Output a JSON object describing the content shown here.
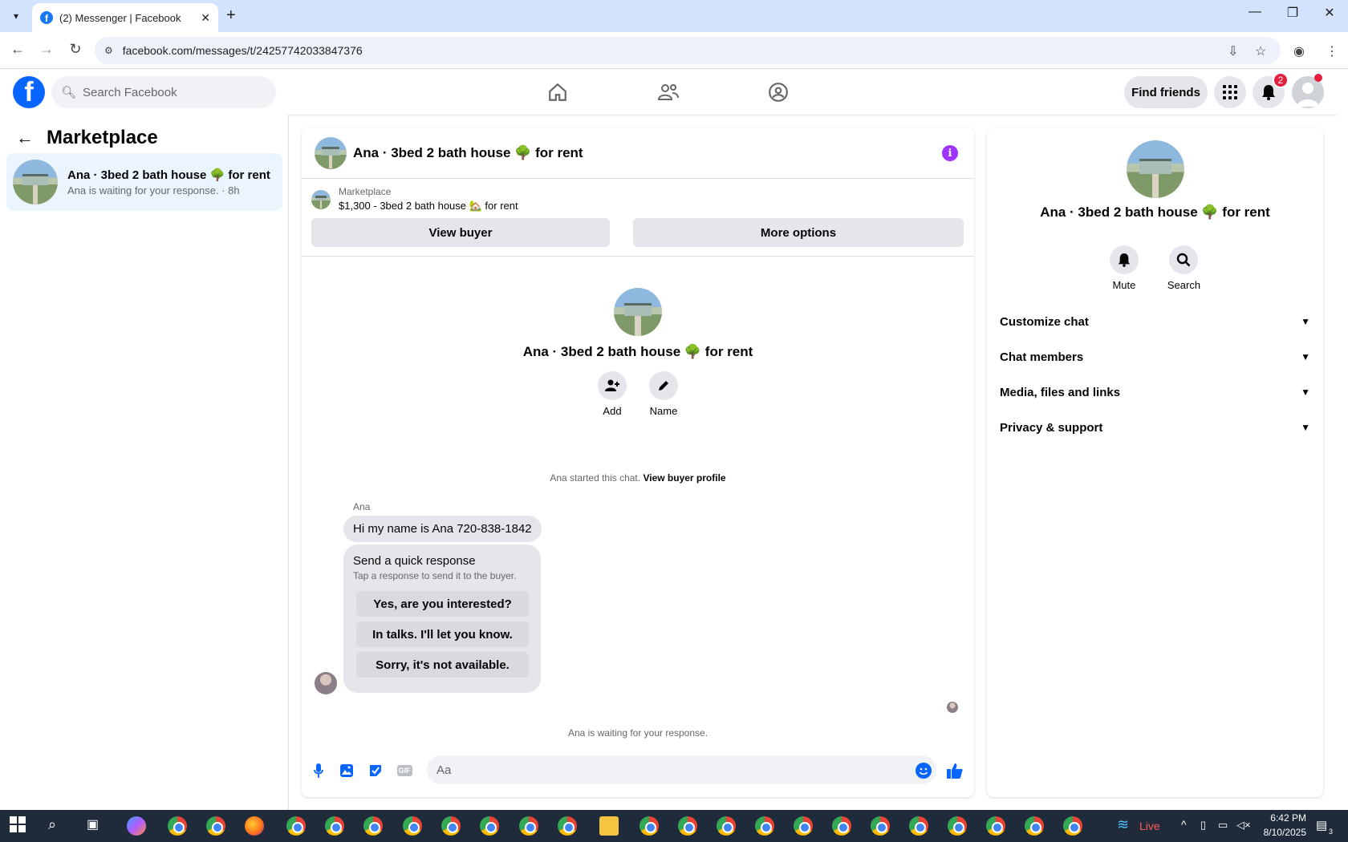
{
  "browser": {
    "tab_title": "(2) Messenger | Facebook",
    "url": "facebook.com/messages/t/24257742033847376"
  },
  "fb_header": {
    "search_placeholder": "Search Facebook",
    "find_friends": "Find friends",
    "notification_count": "2"
  },
  "left_panel": {
    "title": "Marketplace",
    "conversation": {
      "title": "Ana · 3bed 2 bath house 🌳 for rent",
      "subtitle": "Ana is waiting for your response. · 8h"
    }
  },
  "chat": {
    "header_title": "Ana · 3bed 2 bath house 🌳 for rent",
    "marketplace_label": "Marketplace",
    "listing": "$1,300 - 3bed 2 bath house 🏡 for rent",
    "view_buyer": "View buyer",
    "more_options": "More options",
    "intro_title": "Ana · 3bed 2 bath house 🌳 for rent",
    "add_label": "Add",
    "name_label": "Name",
    "started_text": "Ana started this chat.",
    "view_buyer_profile": "View buyer profile",
    "sender": "Ana",
    "message": "Hi my name is Ana 720-838-1842",
    "quick_response": {
      "title": "Send a quick response",
      "subtitle": "Tap a response to send it to the buyer.",
      "options": [
        "Yes, are you interested?",
        "In talks. I'll let you know.",
        "Sorry, it's not available."
      ]
    },
    "waiting_text": "Ana is waiting for your response.",
    "composer_placeholder": "Aa"
  },
  "right_panel": {
    "title": "Ana · 3bed 2 bath house 🌳 for rent",
    "mute": "Mute",
    "search": "Search",
    "sections": [
      "Customize chat",
      "Chat members",
      "Media, files and links",
      "Privacy & support"
    ]
  },
  "taskbar": {
    "live": "Live",
    "time": "6:42 PM",
    "date": "8/10/2025",
    "notif": "3"
  }
}
